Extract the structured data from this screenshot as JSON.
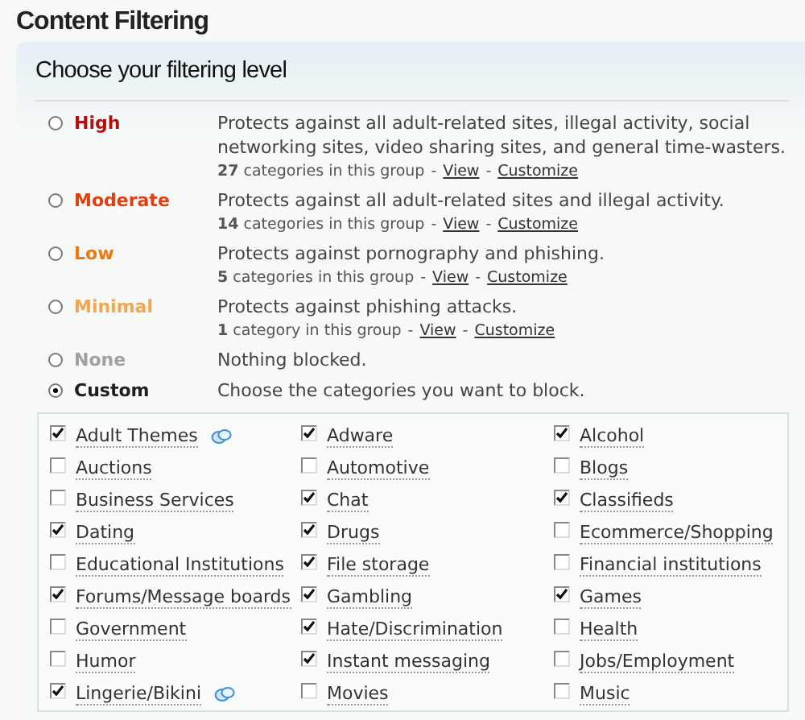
{
  "page_title": "Content Filtering",
  "panel_title": "Choose your filtering level",
  "levels": [
    {
      "name": "High",
      "color": "#b01010",
      "selected": false,
      "description": "Protects against all adult-related sites, illegal activity, social networking sites, video sharing sites, and general time-wasters.",
      "meta": {
        "count": "27",
        "text": "categories in this group",
        "dash1": "-",
        "view": "View",
        "dash2": "-",
        "customize": "Customize"
      }
    },
    {
      "name": "Moderate",
      "color": "#e04010",
      "selected": false,
      "description": "Protects against all adult-related sites and illegal activity.",
      "meta": {
        "count": "14",
        "text": "categories in this group",
        "dash1": "-",
        "view": "View",
        "dash2": "-",
        "customize": "Customize"
      }
    },
    {
      "name": "Low",
      "color": "#f07810",
      "selected": false,
      "description": "Protects against pornography and phishing.",
      "meta": {
        "count": "5",
        "text": "categories in this group",
        "dash1": "-",
        "view": "View",
        "dash2": "-",
        "customize": "Customize"
      }
    },
    {
      "name": "Minimal",
      "color": "#f0a850",
      "selected": false,
      "description": "Protects against phishing attacks.",
      "meta": {
        "count": "1",
        "text": "category in this group",
        "dash1": "-",
        "view": "View",
        "dash2": "-",
        "customize": "Customize"
      }
    },
    {
      "name": "None",
      "color": "#a0a0a0",
      "selected": false,
      "description": "Nothing blocked."
    },
    {
      "name": "Custom",
      "color": "#202020",
      "selected": true,
      "description": "Choose the categories you want to block."
    }
  ],
  "categories": [
    {
      "label": "Adult Themes",
      "checked": true,
      "info": true
    },
    {
      "label": "Adware",
      "checked": true,
      "info": false
    },
    {
      "label": "Alcohol",
      "checked": true,
      "info": false
    },
    {
      "label": "Auctions",
      "checked": false,
      "info": false
    },
    {
      "label": "Automotive",
      "checked": false,
      "info": false
    },
    {
      "label": "Blogs",
      "checked": false,
      "info": false
    },
    {
      "label": "Business Services",
      "checked": false,
      "info": false
    },
    {
      "label": "Chat",
      "checked": true,
      "info": false
    },
    {
      "label": "Classifieds",
      "checked": true,
      "info": false
    },
    {
      "label": "Dating",
      "checked": true,
      "info": false
    },
    {
      "label": "Drugs",
      "checked": true,
      "info": false
    },
    {
      "label": "Ecommerce/Shopping",
      "checked": false,
      "info": false
    },
    {
      "label": "Educational Institutions",
      "checked": false,
      "info": false
    },
    {
      "label": "File storage",
      "checked": true,
      "info": false
    },
    {
      "label": "Financial institutions",
      "checked": false,
      "info": false
    },
    {
      "label": "Forums/Message boards",
      "checked": true,
      "info": false
    },
    {
      "label": "Gambling",
      "checked": true,
      "info": false
    },
    {
      "label": "Games",
      "checked": true,
      "info": false
    },
    {
      "label": "Government",
      "checked": false,
      "info": false
    },
    {
      "label": "Hate/Discrimination",
      "checked": true,
      "info": false
    },
    {
      "label": "Health",
      "checked": false,
      "info": false
    },
    {
      "label": "Humor",
      "checked": false,
      "info": false
    },
    {
      "label": "Instant messaging",
      "checked": true,
      "info": false
    },
    {
      "label": "Jobs/Employment",
      "checked": false,
      "info": false
    },
    {
      "label": "Lingerie/Bikini",
      "checked": true,
      "info": true
    },
    {
      "label": "Movies",
      "checked": false,
      "info": false
    },
    {
      "label": "Music",
      "checked": false,
      "info": false
    }
  ]
}
